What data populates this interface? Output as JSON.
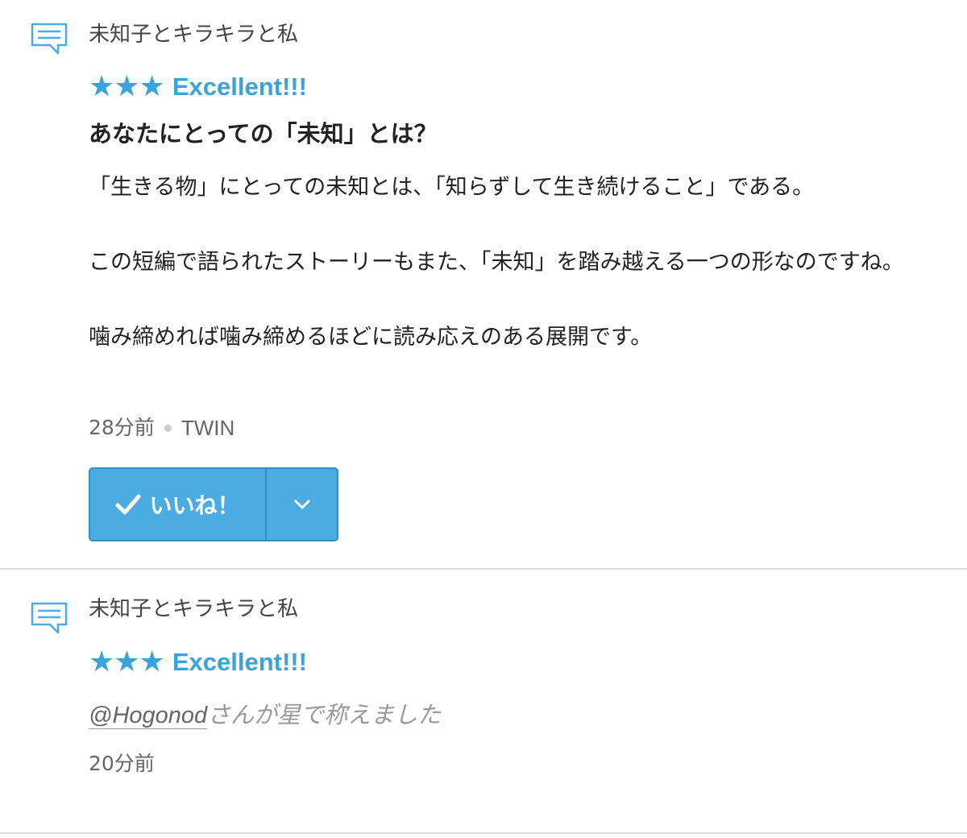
{
  "reviews": [
    {
      "work_title": "未知子とキラキラと私",
      "stars": "★★★",
      "rating_label": "Excellent!!!",
      "heading": "あなたにとっての「未知」とは？",
      "body": [
        "「生きる物」にとっての未知とは、「知らずして生き続けること」である。",
        "この短編で語られたストーリーもまた、「未知」を踏み越える一つの形なのですね。",
        "噛み締めれば噛み締めるほどに読み応えのある展開です。"
      ],
      "time": "28分前",
      "user": "TWIN",
      "like_label": "いいね！",
      "icon": "comment-icon"
    },
    {
      "work_title": "未知子とキラキラと私",
      "stars": "★★★",
      "rating_label": "Excellent!!!",
      "mention": "@Hogonod",
      "activity_suffix": "さんが星で称えました",
      "time": "20分前",
      "icon": "comment-icon"
    }
  ],
  "colors": {
    "accent": "#3ba3dc",
    "button_bg": "#4aace2",
    "button_border": "#2f8fc8",
    "divider": "#dddddd"
  }
}
